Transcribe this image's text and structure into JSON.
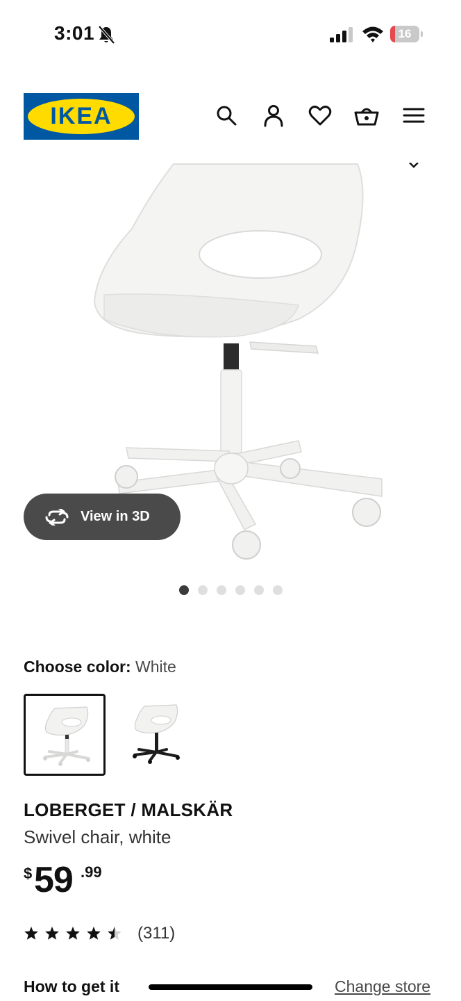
{
  "status_bar": {
    "time": "3:01",
    "battery_level": "16",
    "icons": [
      "bell-slash-icon",
      "cellular-signal-icon",
      "wifi-icon",
      "battery-icon"
    ]
  },
  "header": {
    "logo_text": "IKEA",
    "icons": [
      "search-icon",
      "account-icon",
      "heart-icon",
      "cart-icon",
      "menu-icon"
    ],
    "colors": {
      "logo_blue": "#0058a3",
      "logo_yellow": "#ffdb00"
    }
  },
  "gallery": {
    "view3d_label": "View in 3D",
    "image_count": 6,
    "active_index": 0
  },
  "color_chooser": {
    "label": "Choose color:",
    "selected_value": "White",
    "options": [
      {
        "name": "White",
        "selected": true
      },
      {
        "name": "Black",
        "selected": false
      }
    ]
  },
  "product": {
    "name": "LOBERGET / MALSKÄR",
    "description": "Swivel chair, white",
    "price": {
      "currency": "$",
      "integer": "59",
      "decimal": ".99"
    },
    "rating": {
      "stars": 4.5,
      "max": 5,
      "review_count": "(311)"
    }
  },
  "footer": {
    "how_to_get": "How to get it",
    "change_store": "Change store"
  }
}
